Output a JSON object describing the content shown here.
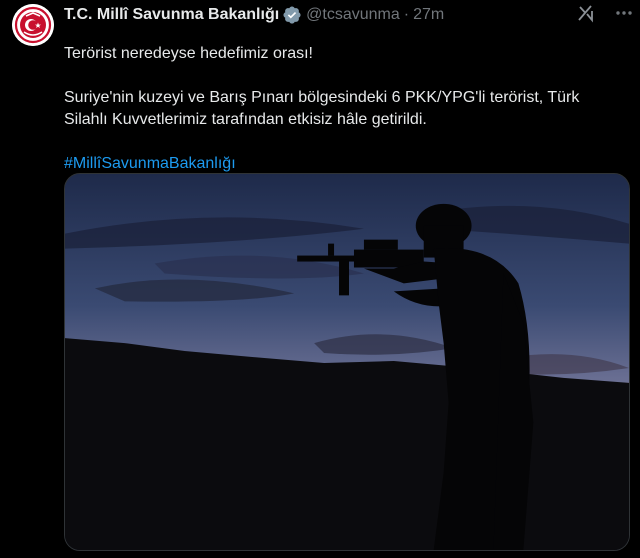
{
  "post": {
    "author": {
      "display_name": "T.C. Millî Savunma Bakanlığı",
      "handle": "@tcsavunma",
      "verified_icon": "verified-badge-gray-icon",
      "avatar": "mod-emblem-avatar"
    },
    "separator": "·",
    "timestamp": "27m",
    "text_line1": "Terörist neredeyse hedefimiz orası!",
    "text_paragraph2": "Suriye'nin kuzeyi ve Barış Pınarı bölgesindeki 6 PKK/YPG'li terörist, Türk Silahlı Kuvvetlerimiz tarafından etkisiz hâle getirildi.",
    "hashtag": "#MillîSavunmaBakanlığı",
    "media": {
      "type": "photo",
      "description_icon": "soldier-silhouette-dusk-photo"
    },
    "icons": {
      "grok": "grok-icon",
      "more": "more-options-icon"
    }
  },
  "colors": {
    "background": "#000000",
    "text": "#e7e9ea",
    "secondary_text": "#71767b",
    "link": "#1d9bf0",
    "avatar_red": "#c8102e"
  }
}
